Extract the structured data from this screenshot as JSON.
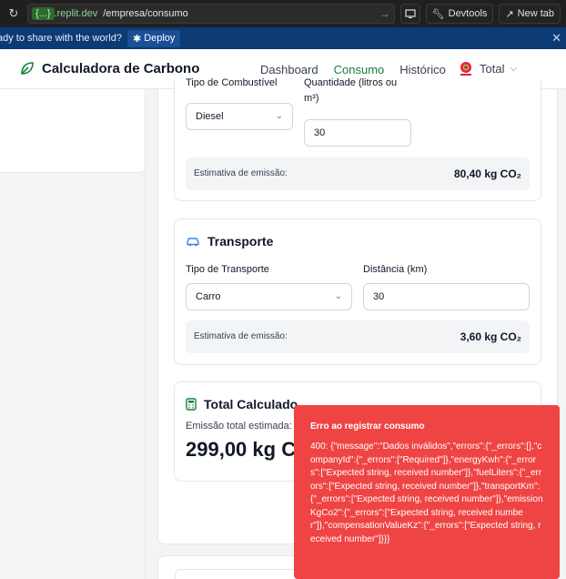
{
  "browser": {
    "url_tag": "{...}",
    "url_host": ".replit.dev",
    "url_path": "/empresa/consumo",
    "devtools_label": "Devtools",
    "newtab_label": "New tab"
  },
  "deploybar": {
    "text": "ady to share with the world?",
    "deploy_label": "Deploy"
  },
  "header": {
    "app_title": "Calculadora de Carbono",
    "nav": [
      "Dashboard",
      "Consumo",
      "Histórico"
    ],
    "active_nav": "Consumo",
    "company_name": "Total",
    "brand_color": "#15803d"
  },
  "combustivel": {
    "tipo_label": "Tipo de Combustível",
    "tipo_value": "Diesel",
    "quantidade_label_line1": "Quantidade (litros ou",
    "quantidade_label_line2": "m³)",
    "quantidade_value": "30",
    "estimativa_label": "Estimativa de emissão:",
    "estimativa_value": "80,40 kg CO₂"
  },
  "transporte": {
    "title": "Transporte",
    "tipo_label": "Tipo de Transporte",
    "tipo_value": "Carro",
    "distancia_label": "Distância (km)",
    "distancia_value": "30",
    "estimativa_label": "Estimativa de emissão:",
    "estimativa_value": "3,60 kg CO₂"
  },
  "total": {
    "title": "Total Calculado",
    "label": "Emissão total estimada:",
    "value": "299,00 kg C"
  },
  "toast": {
    "title": "Erro ao registrar consumo",
    "message": "400: {\"message\":\"Dados inválidos\",\"errors\":{\"_errors\":[],\"companyId\":{\"_errors\":[\"Required\"]},\"energyKwh\":{\"_errors\":[\"Expected string, received number\"]},\"fuelLiters\":{\"_errors\":[\"Expected string, received number\"]},\"transportKm\":{\"_errors\":[\"Expected string, received number\"]},\"emissionKgCo2\":{\"_errors\":[\"Expected string, received number\"]},\"compensationValueKz\":{\"_errors\":[\"Expected string, received number\"]}}}",
    "color": "#ef4444"
  }
}
